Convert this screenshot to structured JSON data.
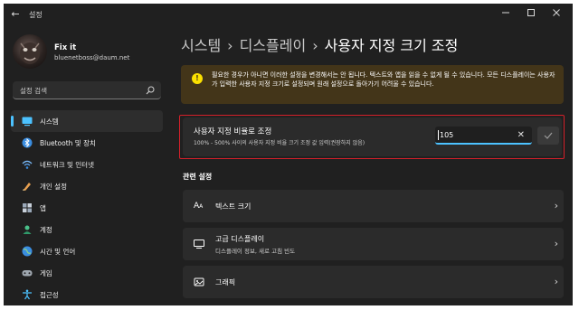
{
  "window": {
    "title": "설정"
  },
  "user": {
    "name": "Fix it",
    "email": "bluenetboss@daum.net"
  },
  "search": {
    "placeholder": "설정 검색"
  },
  "sidebar": {
    "items": [
      {
        "label": "시스템",
        "icon": "system-icon",
        "active": true
      },
      {
        "label": "Bluetooth 및 장치",
        "icon": "bluetooth-icon"
      },
      {
        "label": "네트워크 및 인터넷",
        "icon": "network-icon"
      },
      {
        "label": "개인 설정",
        "icon": "personalization-icon"
      },
      {
        "label": "앱",
        "icon": "apps-icon"
      },
      {
        "label": "계정",
        "icon": "accounts-icon"
      },
      {
        "label": "시간 및 언어",
        "icon": "time-language-icon"
      },
      {
        "label": "게임",
        "icon": "gaming-icon"
      },
      {
        "label": "접근성",
        "icon": "accessibility-icon"
      }
    ]
  },
  "breadcrumb": {
    "items": [
      "시스템",
      "디스플레이",
      "사용자 지정 크기 조정"
    ],
    "separator": "›"
  },
  "warning": {
    "icon": "warning-icon",
    "text": "필요한 경우가 아니면 이러한 설정을 변경해서는 안 됩니다. 텍스트와 앱을 읽을 수 없게 될 수 있습니다. 모든 디스플레이는 사용자가 입력한 사용자 지정 크기로 설정되며 원래 설정으로 돌아가기 어려울 수 있습니다."
  },
  "custom_scaling": {
    "title": "사용자 지정 비율로 조정",
    "description": "100% - 500% 사이의 사용자 지정 비율 크기 조정 값 입력(권장하지 않음)",
    "value": "105"
  },
  "related": {
    "heading": "관련 설정",
    "rows": [
      {
        "label": "텍스트 크기",
        "sub": "",
        "icon": "text-size-icon"
      },
      {
        "label": "고급 디스플레이",
        "sub": "디스플레이 정보, 새로 고침 빈도",
        "icon": "monitor-icon"
      },
      {
        "label": "그래픽",
        "sub": "",
        "icon": "graphics-icon"
      }
    ]
  },
  "colors": {
    "background": "#202020",
    "card": "#2b2b2b",
    "accent": "#4cc2ff",
    "warning_bg": "#433519",
    "warning_icon": "#fce100",
    "highlight": "#d4202a"
  }
}
